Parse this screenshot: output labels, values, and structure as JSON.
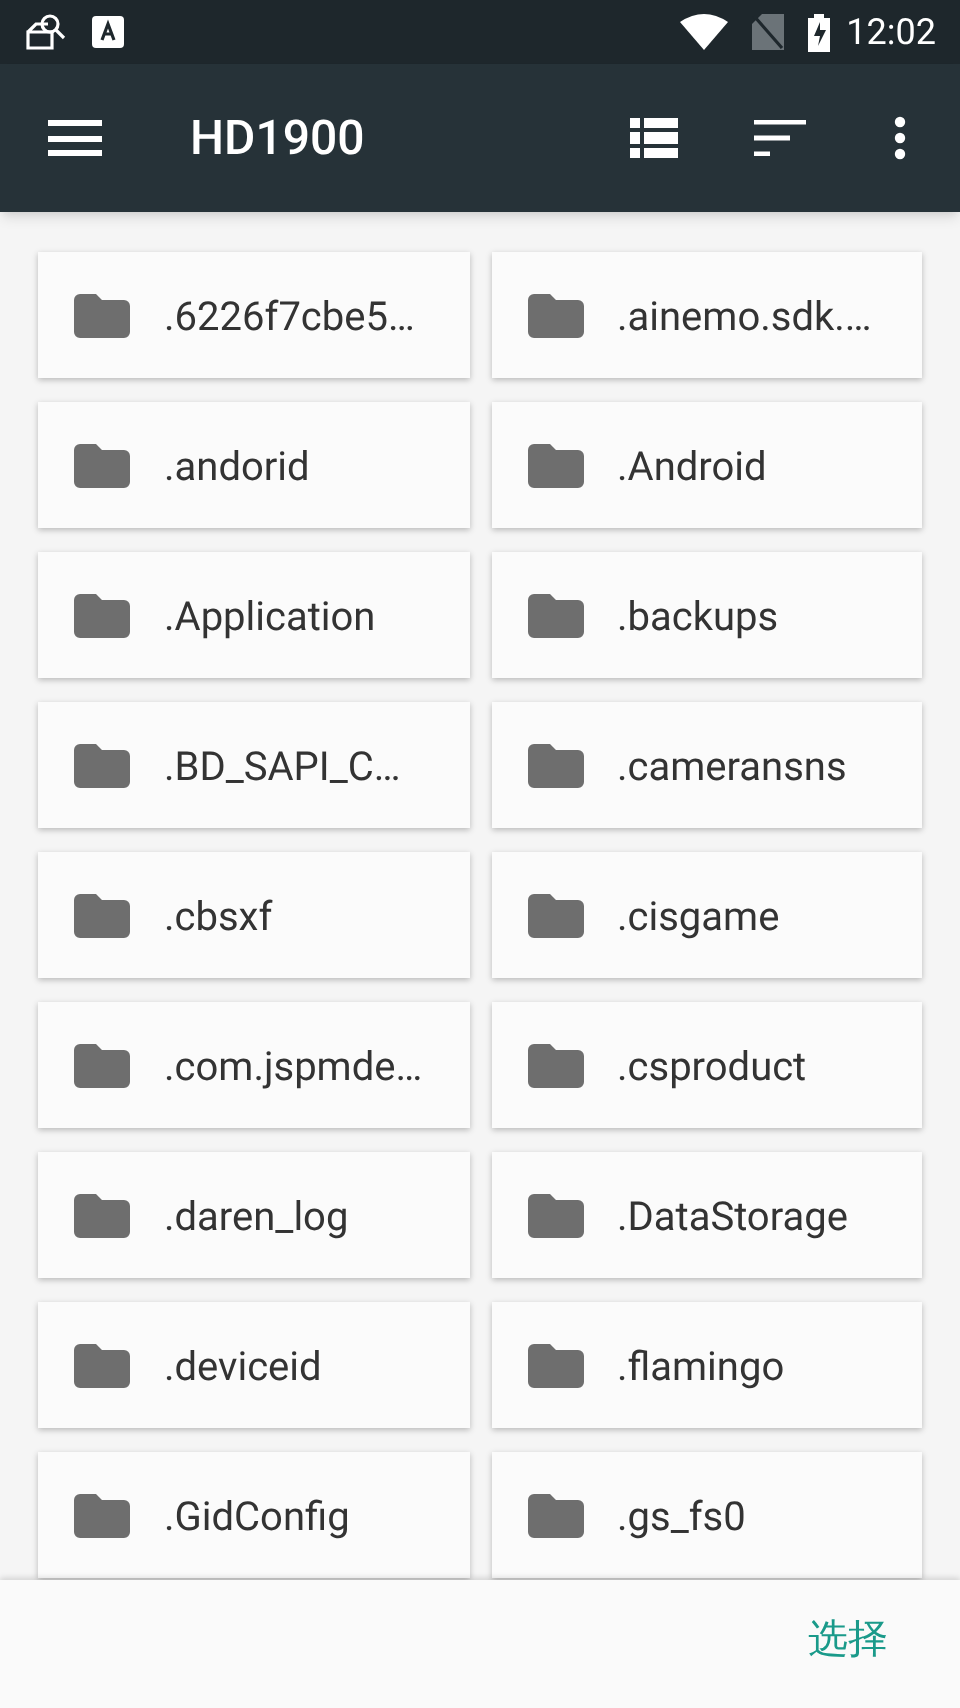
{
  "status_bar": {
    "time": "12:02"
  },
  "toolbar": {
    "title": "HD1900"
  },
  "folders": [
    {
      "name": ".6226f7cbe5…"
    },
    {
      "name": ".ainemo.sdk.…"
    },
    {
      "name": ".andorid"
    },
    {
      "name": ".Android"
    },
    {
      "name": ".Application"
    },
    {
      "name": ".backups"
    },
    {
      "name": ".BD_SAPI_C…"
    },
    {
      "name": ".cameransns"
    },
    {
      "name": ".cbsxf"
    },
    {
      "name": ".cisgame"
    },
    {
      "name": ".com.jspmde…"
    },
    {
      "name": ".csproduct"
    },
    {
      "name": ".daren_log"
    },
    {
      "name": ".DataStorage"
    },
    {
      "name": ".deviceid"
    },
    {
      "name": ".flamingo"
    },
    {
      "name": ".GidConfig"
    },
    {
      "name": ".gs_fs0"
    }
  ],
  "bottom_bar": {
    "select_button": "选择"
  }
}
